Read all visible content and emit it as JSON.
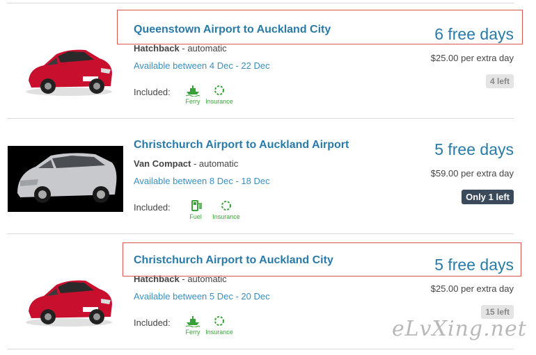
{
  "labels": {
    "included": "Included:"
  },
  "listings": [
    {
      "title": "Queenstown Airport to Auckland City",
      "vehicle": "Hatchback",
      "transmission": "automatic",
      "availability": "Available between 4 Dec - 22 Dec",
      "free_days": "6 free days",
      "extra_price": "$25.00 per extra day",
      "stock": "4 left",
      "features": [
        "Ferry",
        "Insurance"
      ]
    },
    {
      "title": "Christchurch Airport to Auckland Airport",
      "vehicle": "Van Compact",
      "transmission": "automatic",
      "availability": "Available between 8 Dec - 18 Dec",
      "free_days": "5 free days",
      "extra_price": "$59.00 per extra day",
      "stock": "Only 1 left",
      "features": [
        "Fuel",
        "Insurance"
      ]
    },
    {
      "title": "Christchurch Airport to Auckland City",
      "vehicle": "Hatchback",
      "transmission": "automatic",
      "availability": "Available between 5 Dec - 20 Dec",
      "free_days": "5 free days",
      "extra_price": "$25.00 per extra day",
      "stock": "15 left",
      "features": [
        "Ferry",
        "Insurance"
      ]
    }
  ],
  "watermark": "eLvXing.net",
  "colors": {
    "title": "#2a7aa8",
    "availability": "#3a8fbf",
    "feature": "#3aa03a",
    "highlight_box": "#d9534f",
    "badge_dark": "#3a4a5a"
  }
}
